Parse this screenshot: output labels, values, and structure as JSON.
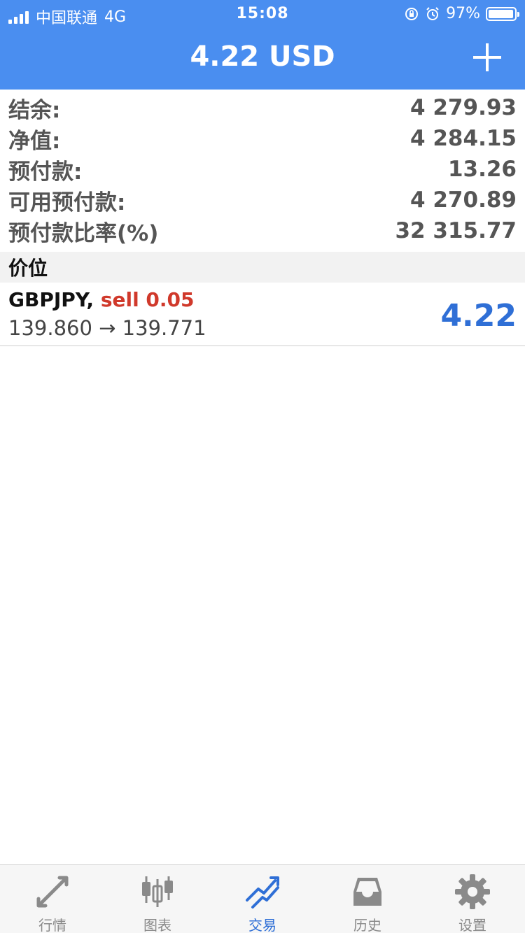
{
  "status_bar": {
    "carrier": "中国联通",
    "network": "4G",
    "time": "15:08",
    "battery_percent": "97%",
    "battery_level": 0.97
  },
  "nav": {
    "title": "4.22 USD",
    "add_icon": "plus-icon"
  },
  "summary": [
    {
      "label": "结余:",
      "value": "4 279.93"
    },
    {
      "label": "净值:",
      "value": "4 284.15"
    },
    {
      "label": "预付款:",
      "value": "13.26"
    },
    {
      "label": "可用预付款:",
      "value": "4 270.89"
    },
    {
      "label": "预付款比率(%)",
      "value": "32 315.77"
    }
  ],
  "section_title": "价位",
  "position": {
    "symbol": "GBPJPY,",
    "side": "sell 0.05",
    "price_change": "139.860 → 139.771",
    "profit": "4.22"
  },
  "tabs": [
    {
      "label": "行情",
      "icon": "quotes-icon"
    },
    {
      "label": "图表",
      "icon": "chart-candles-icon"
    },
    {
      "label": "交易",
      "icon": "trade-icon",
      "active": true
    },
    {
      "label": "历史",
      "icon": "history-inbox-icon"
    },
    {
      "label": "设置",
      "icon": "gear-icon"
    }
  ],
  "colors": {
    "header_blue": "#4a8ef0",
    "active_blue": "#2f6fd6",
    "sell_red": "#d0392b",
    "inactive_gray": "#8a8a8a"
  }
}
